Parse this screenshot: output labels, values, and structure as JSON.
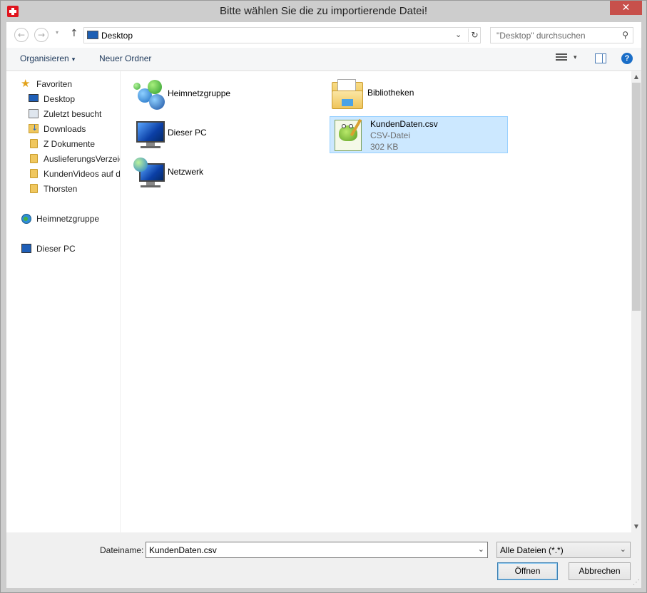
{
  "window": {
    "title": "Bitte wählen Sie die zu importierende Datei!",
    "close_symbol": "✕"
  },
  "nav": {
    "back": "←",
    "forward": "→",
    "drop": "▾",
    "up": "↑"
  },
  "address": {
    "location": "Desktop",
    "chevron": "⌄",
    "refresh": "↻"
  },
  "search": {
    "placeholder": "\"Desktop\" durchsuchen",
    "icon": "search-icon"
  },
  "toolbar": {
    "organize_label": "Organisieren",
    "organize_arrow": "▾",
    "new_folder_label": "Neuer Ordner",
    "views_arrow": "▾",
    "help_label": "?"
  },
  "sidebar": {
    "favorites_label": "Favoriten",
    "items": [
      {
        "label": "Desktop",
        "icon": "desktop-icon"
      },
      {
        "label": "Zuletzt besucht",
        "icon": "recent-places-icon"
      },
      {
        "label": "Downloads",
        "icon": "downloads-icon"
      },
      {
        "label": "Z Dokumente",
        "icon": "folder-icon"
      },
      {
        "label": "AuslieferungsVerzeic",
        "icon": "folder-icon"
      },
      {
        "label": "KundenVideos auf d",
        "icon": "folder-icon"
      },
      {
        "label": "Thorsten",
        "icon": "folder-icon"
      }
    ],
    "homegroup_label": "Heimnetzgruppe",
    "this_pc_label": "Dieser PC"
  },
  "content": {
    "items": [
      {
        "name": "Heimnetzgruppe",
        "icon": "homegroup-icon"
      },
      {
        "name": "Bibliotheken",
        "icon": "libraries-icon"
      },
      {
        "name": "Dieser PC",
        "icon": "computer-icon"
      },
      {
        "name": "KundenDaten.csv",
        "type": "CSV-Datei",
        "size": "302 KB",
        "icon": "csv-file-icon",
        "selected": true
      },
      {
        "name": "Netzwerk",
        "icon": "network-icon"
      }
    ]
  },
  "scrollbar": {
    "up": "▲",
    "down": "▼"
  },
  "bottom": {
    "filename_label": "Dateiname:",
    "filename_value": "KundenDaten.csv",
    "filename_chevron": "⌄",
    "filter_value": "Alle Dateien (*.*)",
    "filter_chevron": "⌄",
    "open_label": "Öffnen",
    "cancel_label": "Abbrechen"
  },
  "colors": {
    "selection_fill": "#cce8ff",
    "selection_border": "#99d1ff",
    "link_text": "#1e395b",
    "close_button": "#c7504b"
  }
}
